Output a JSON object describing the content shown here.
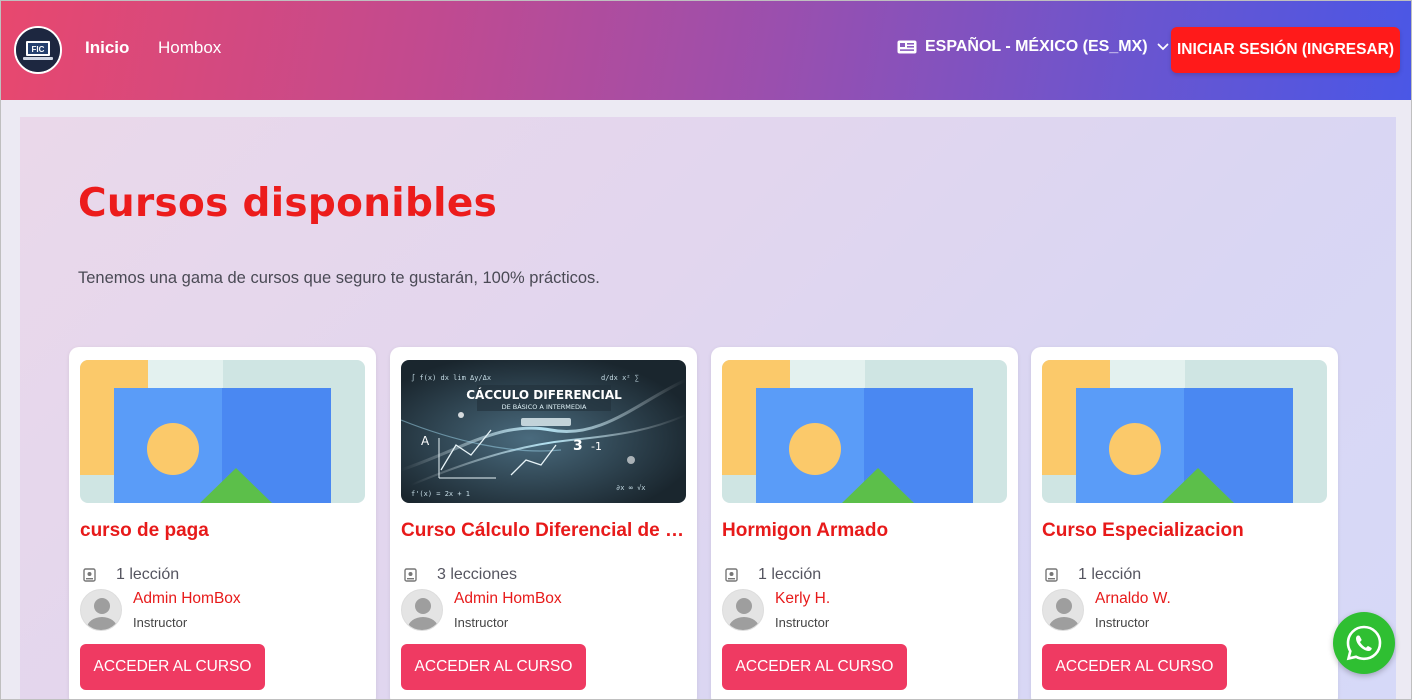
{
  "header": {
    "logo_text": "FIC",
    "nav": [
      {
        "label": "Inicio"
      },
      {
        "label": "Hombox"
      }
    ],
    "language": "ESPAÑOL - MÉXICO (ES_MX)",
    "login_label": "INICIAR SESIÓN (INGRESAR)"
  },
  "main": {
    "title": "Cursos disponibles",
    "subtitle": "Tenemos una gama de cursos que seguro te gustarán, 100% prácticos."
  },
  "courses": [
    {
      "title": "curso de paga",
      "lessons": "1 lección",
      "instructor": "Admin HomBox",
      "role": "Instructor",
      "button": "ACCEDER AL CURSO",
      "image": "placeholder-image"
    },
    {
      "title": "Curso Cálculo Diferencial de Básico a Intermedio",
      "lessons": "3 lecciones",
      "instructor": "Admin HomBox",
      "role": "Instructor",
      "button": "ACCEDER AL CURSO",
      "image": "calculus-thumbnail",
      "image_text": "CÁCCULO DIFERENCIAL",
      "image_subtext": "DE BÁSICO A INTERMEDIA"
    },
    {
      "title": "Hormigon Armado",
      "lessons": "1 lección",
      "instructor": "Kerly H.",
      "role": "Instructor",
      "button": "ACCEDER AL CURSO",
      "image": "placeholder-image"
    },
    {
      "title": "Curso Especializacion",
      "lessons": "1 lección",
      "instructor": "Arnaldo W.",
      "role": "Instructor",
      "button": "ACCEDER AL CURSO",
      "image": "placeholder-image"
    }
  ],
  "colors": {
    "accent_red": "#e71a1a",
    "button_pink": "#ef3a62",
    "login_red": "#ff1a1a",
    "whatsapp_green": "#2fbf32"
  },
  "icons": {
    "language": "language-card-icon",
    "dropdown": "chevron-down-icon",
    "lesson": "lesson-book-icon",
    "whatsapp": "whatsapp-icon"
  }
}
